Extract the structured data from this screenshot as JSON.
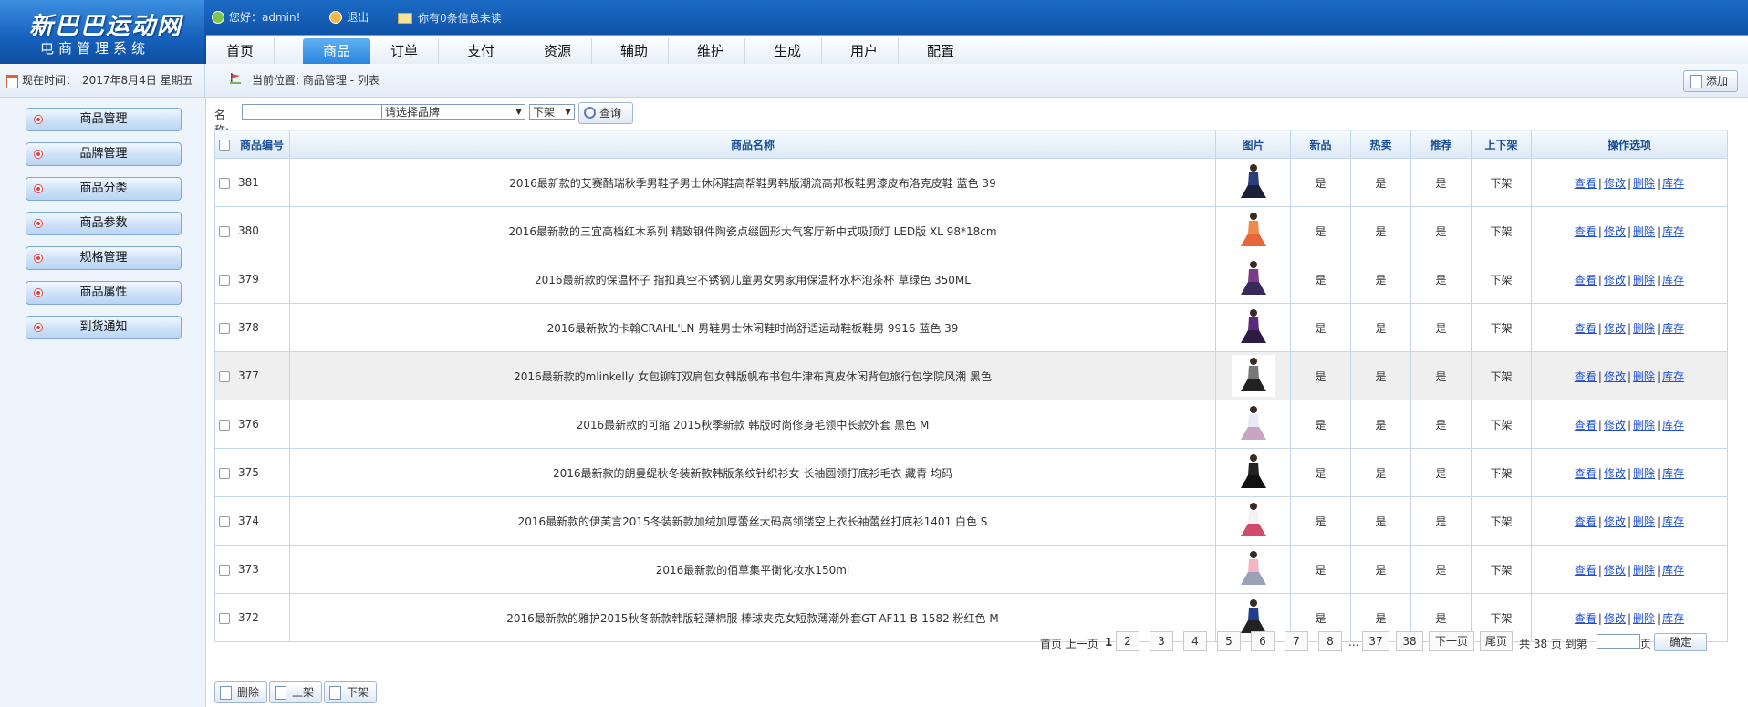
{
  "app": {
    "title": "新巴巴运动网",
    "subtitle": "电商管理系统"
  },
  "topbar": {
    "greeting": "您好：admin!",
    "logout": "退出",
    "messages": "你有0条信息未读"
  },
  "nav": {
    "tabs": [
      "首页",
      "商品",
      "订单",
      "支付",
      "资源",
      "辅助",
      "维护",
      "生成",
      "用户",
      "配置"
    ],
    "active": "商品"
  },
  "datebar": {
    "label": "现在时间：",
    "value": "2017年8月4日 星期五"
  },
  "breadcrumb": "当前位置: 商品管理 - 列表",
  "add_button": "添加",
  "sidebar": {
    "items": [
      "商品管理",
      "品牌管理",
      "商品分类",
      "商品参数",
      "规格管理",
      "商品属性",
      "到货通知"
    ]
  },
  "search": {
    "name_label": "名称:",
    "name_value": "",
    "brand_select": "请选择品牌",
    "status_select": "下架",
    "query_button": "查询"
  },
  "table": {
    "headers": [
      "商品编号",
      "商品名称",
      "图片",
      "新品",
      "热卖",
      "推荐",
      "上下架",
      "操作选项"
    ],
    "ops": [
      "查看",
      "修改",
      "删除",
      "库存"
    ],
    "rows": [
      {
        "id": "381",
        "name": "2016最新款的艾赛酷瑞秋季男鞋子男士休闲鞋高帮鞋男韩版潮流高邦板鞋男漆皮布洛克皮鞋 蓝色 39",
        "new": "是",
        "hot": "是",
        "rec": "是",
        "shelf": "下架"
      },
      {
        "id": "380",
        "name": "2016最新款的三宜高档红木系列 精致钢件陶瓷点缀圆形大气客厅新中式吸顶灯 LED版 XL 98*18cm",
        "new": "是",
        "hot": "是",
        "rec": "是",
        "shelf": "下架"
      },
      {
        "id": "379",
        "name": "2016最新款的保温杯子 指扣真空不锈钢儿童男女男家用保温杯水杯泡茶杯 草绿色 350ML",
        "new": "是",
        "hot": "是",
        "rec": "是",
        "shelf": "下架"
      },
      {
        "id": "378",
        "name": "2016最新款的卡翰CRAHL'LN 男鞋男士休闲鞋时尚舒适运动鞋板鞋男 9916 蓝色 39",
        "new": "是",
        "hot": "是",
        "rec": "是",
        "shelf": "下架"
      },
      {
        "id": "377",
        "name": "2016最新款的mlinkelly 女包铆钉双肩包女韩版帆布书包牛津布真皮休闲背包旅行包学院风潮 黑色",
        "new": "是",
        "hot": "是",
        "rec": "是",
        "shelf": "下架"
      },
      {
        "id": "376",
        "name": "2016最新款的可缩 2015秋季新款 韩版时尚修身毛领中长款外套 黑色 M",
        "new": "是",
        "hot": "是",
        "rec": "是",
        "shelf": "下架"
      },
      {
        "id": "375",
        "name": "2016最新款的朗曼缇秋冬装新款韩版条纹针织衫女 长袖圆领打底衫毛衣 藏青 均码",
        "new": "是",
        "hot": "是",
        "rec": "是",
        "shelf": "下架"
      },
      {
        "id": "374",
        "name": "2016最新款的伊芙言2015冬装新款加绒加厚蕾丝大码高领镂空上衣长袖蕾丝打底衫1401 白色 S",
        "new": "是",
        "hot": "是",
        "rec": "是",
        "shelf": "下架"
      },
      {
        "id": "373",
        "name": "2016最新款的佰草集平衡化妆水150ml",
        "new": "是",
        "hot": "是",
        "rec": "是",
        "shelf": "下架"
      },
      {
        "id": "372",
        "name": "2016最新款的雅护2015秋冬新款韩版轻薄棉服 棒球夹克女短款薄潮外套GT-AF11-B-1582 粉红色 M",
        "new": "是",
        "hot": "是",
        "rec": "是",
        "shelf": "下架"
      }
    ]
  },
  "pager": {
    "first_prev": "首页 上一页",
    "current": "1",
    "pages": [
      "2",
      "3",
      "4",
      "5",
      "6",
      "7",
      "8"
    ],
    "ellipsis": "...",
    "tail": [
      "37",
      "38"
    ],
    "next": "下一页",
    "last": "尾页",
    "total": "共 38 页 到第",
    "page_suffix": "页",
    "confirm": "确定"
  },
  "bottom_buttons": [
    "删除",
    "上架",
    "下架"
  ]
}
